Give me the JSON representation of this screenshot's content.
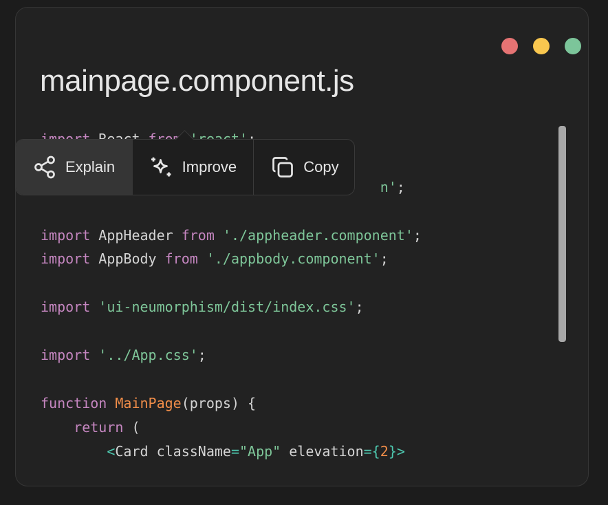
{
  "window": {
    "controls": [
      {
        "name": "close",
        "color": "#e57373"
      },
      {
        "name": "minimize",
        "color": "#f9c74f"
      },
      {
        "name": "maximize",
        "color": "#7cc59a"
      }
    ]
  },
  "file": {
    "title": "mainpage.component.js"
  },
  "code": {
    "lines": [
      [
        {
          "t": "import",
          "c": "kw"
        },
        {
          "t": " React ",
          "c": "plain"
        },
        {
          "t": "from",
          "c": "kw"
        },
        {
          "t": " ",
          "c": "plain"
        },
        {
          "t": "'react'",
          "c": "str"
        },
        {
          "t": ";",
          "c": "plain"
        }
      ],
      [],
      [
        {
          "t": "                                         ",
          "c": "plain"
        },
        {
          "t": "n'",
          "c": "str"
        },
        {
          "t": ";",
          "c": "plain"
        }
      ],
      [],
      [
        {
          "t": "import",
          "c": "kw"
        },
        {
          "t": " AppHeader ",
          "c": "plain"
        },
        {
          "t": "from",
          "c": "kw"
        },
        {
          "t": " ",
          "c": "plain"
        },
        {
          "t": "'./appheader.component'",
          "c": "str"
        },
        {
          "t": ";",
          "c": "plain"
        }
      ],
      [
        {
          "t": "import",
          "c": "kw"
        },
        {
          "t": " AppBody ",
          "c": "plain"
        },
        {
          "t": "from",
          "c": "kw"
        },
        {
          "t": " ",
          "c": "plain"
        },
        {
          "t": "'./appbody.component'",
          "c": "str"
        },
        {
          "t": ";",
          "c": "plain"
        }
      ],
      [],
      [
        {
          "t": "import",
          "c": "kw"
        },
        {
          "t": " ",
          "c": "plain"
        },
        {
          "t": "'ui-neumorphism/dist/index.css'",
          "c": "str"
        },
        {
          "t": ";",
          "c": "plain"
        }
      ],
      [],
      [
        {
          "t": "import",
          "c": "kw"
        },
        {
          "t": " ",
          "c": "plain"
        },
        {
          "t": "'../App.css'",
          "c": "str"
        },
        {
          "t": ";",
          "c": "plain"
        }
      ],
      [],
      [
        {
          "t": "function",
          "c": "kw"
        },
        {
          "t": " ",
          "c": "plain"
        },
        {
          "t": "MainPage",
          "c": "fn"
        },
        {
          "t": "(props) {",
          "c": "plain"
        }
      ],
      [
        {
          "t": "    ",
          "c": "plain"
        },
        {
          "t": "return",
          "c": "kw"
        },
        {
          "t": " (",
          "c": "plain"
        }
      ],
      [
        {
          "t": "        ",
          "c": "plain"
        },
        {
          "t": "<",
          "c": "tag"
        },
        {
          "t": "Card className",
          "c": "plain"
        },
        {
          "t": "=",
          "c": "tag"
        },
        {
          "t": "\"App\"",
          "c": "str"
        },
        {
          "t": " elevation",
          "c": "plain"
        },
        {
          "t": "={",
          "c": "tag"
        },
        {
          "t": "2",
          "c": "num"
        },
        {
          "t": "}>",
          "c": "tag"
        }
      ]
    ]
  },
  "popup": {
    "buttons": [
      {
        "id": "explain",
        "label": "Explain",
        "icon": "share-nodes-icon",
        "active": true
      },
      {
        "id": "improve",
        "label": "Improve",
        "icon": "sparkles-icon",
        "active": false
      },
      {
        "id": "copy",
        "label": "Copy",
        "icon": "copy-icon",
        "active": false
      }
    ]
  },
  "scrollbar": {
    "position_fraction": 0.0,
    "visible_fraction": 0.64
  }
}
